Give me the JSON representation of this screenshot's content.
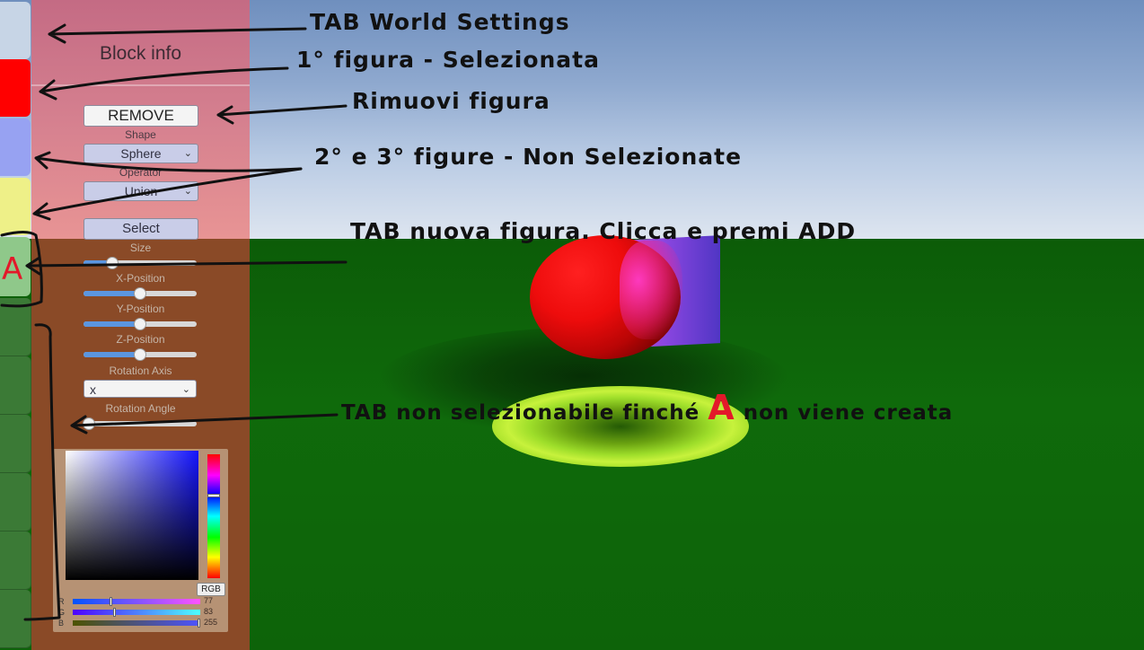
{
  "panel": {
    "title": "Block info",
    "remove_label": "REMOVE",
    "shape_label": "Shape",
    "shape_value": "Sphere",
    "operator_label": "Operator",
    "operator_value": "Union",
    "select_label": "Select",
    "size_label": "Size",
    "x_label": "X-Position",
    "y_label": "Y-Position",
    "z_label": "Z-Position",
    "rot_axis_label": "Rotation Axis",
    "rot_axis_value": "x",
    "rot_angle_label": "Rotation Angle",
    "size_level": 0.25,
    "x_level": 0.5,
    "y_level": 0.5,
    "z_level": 0.5,
    "angle_level": 0.05
  },
  "color_picker": {
    "mode_label": "RGB",
    "r_label": "R",
    "r_value": "77",
    "g_label": "G",
    "g_value": "83",
    "b_label": "B",
    "b_value": "255"
  },
  "tabs": {
    "new_shape_glyph": "A",
    "colors": {
      "world_settings": "#c7d5e6",
      "shape_1": "#ff0000",
      "shape_2": "#97a2f2",
      "shape_3": "#eef088",
      "new_shape": "#8fc88a",
      "disabled": "#3b7a36"
    }
  },
  "annotations": {
    "world_settings": "TAB World Settings",
    "first_selected": "1° figura - Selezionata",
    "remove_shape": "Rimuovi figura",
    "unselected": "2° e 3° figure - Non Selezionate",
    "new_shape_tab": "TAB nuova figura. Clicca e premi ADD",
    "not_selectable_1": "TAB non selezionabile finché",
    "not_selectable_A": "A",
    "not_selectable_2": "non viene creata"
  }
}
